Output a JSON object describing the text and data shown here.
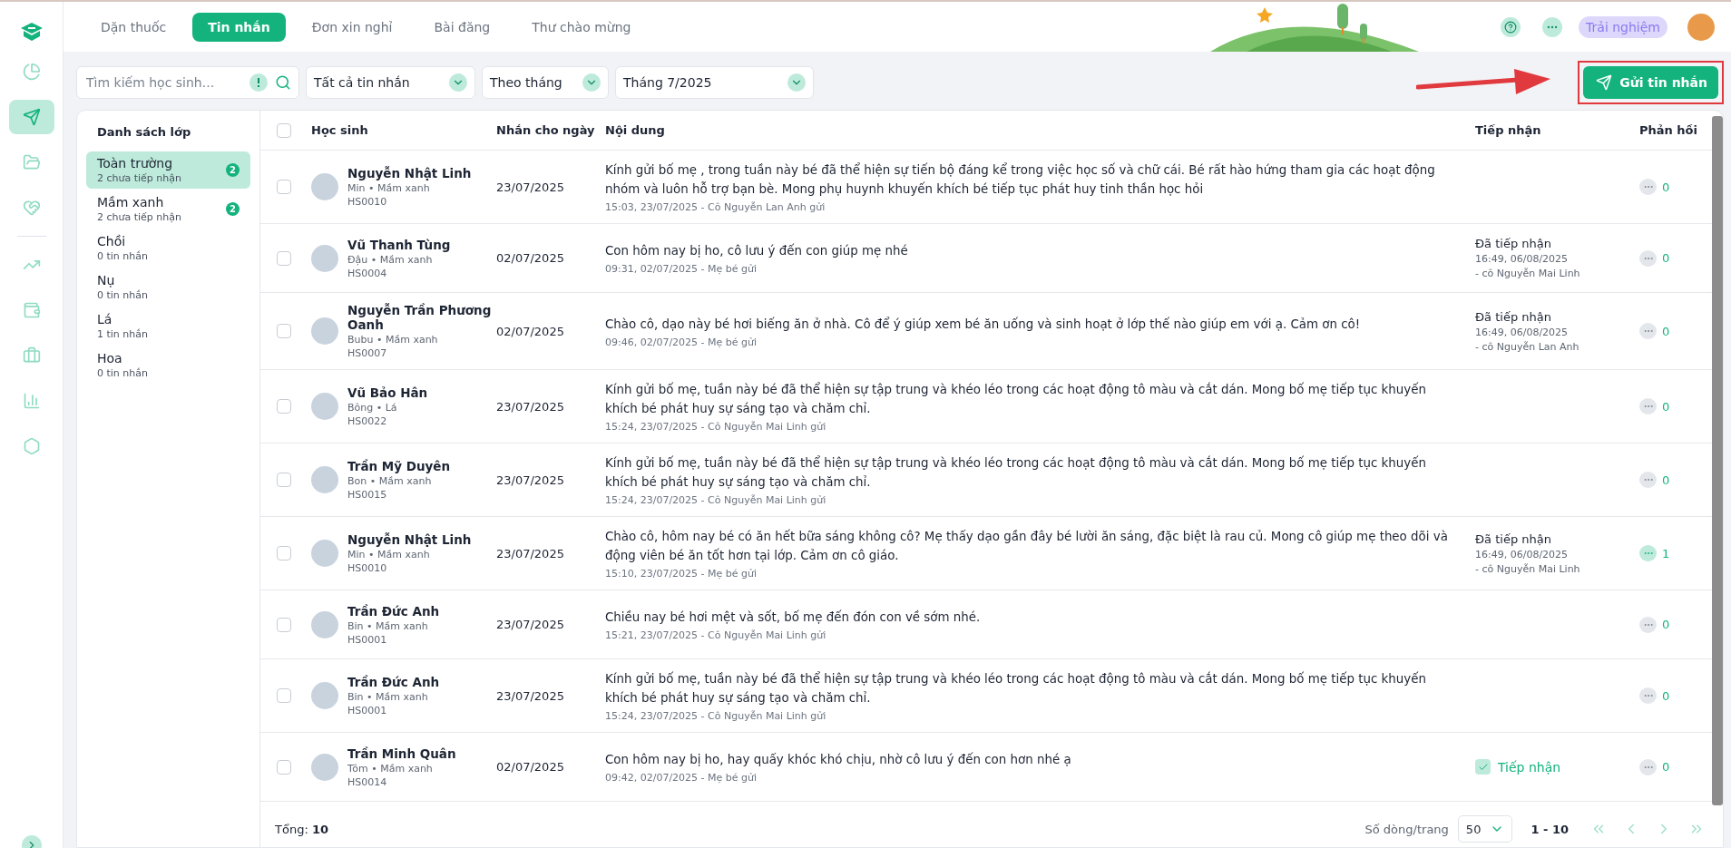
{
  "sidebar": {
    "items": [
      {
        "selected": false
      },
      {
        "selected": true
      },
      {
        "selected": false
      },
      {
        "selected": false
      },
      {
        "selected": false
      },
      {
        "selected": false
      },
      {
        "selected": false
      },
      {
        "selected": false
      },
      {
        "selected": false
      }
    ]
  },
  "tabs": [
    {
      "label": "Dặn thuốc",
      "selected": false
    },
    {
      "label": "Tin nhắn",
      "selected": true
    },
    {
      "label": "Đơn xin nghỉ",
      "selected": false
    },
    {
      "label": "Bài đăng",
      "selected": false
    },
    {
      "label": "Thư chào mừng",
      "selected": false
    }
  ],
  "header": {
    "trial_badge": "Trải nghiệm"
  },
  "filters": {
    "search": {
      "placeholder": "Tìm kiếm học sinh..."
    },
    "selects": [
      {
        "value": "Tất cả tin nhắn"
      },
      {
        "value": "Theo tháng"
      },
      {
        "value": "Tháng 7/2025"
      }
    ]
  },
  "send_button": {
    "label": "Gửi tin nhắn",
    "highlighted": true
  },
  "class_list": {
    "title": "Danh sách lớp",
    "items": [
      {
        "name": "Toàn trường",
        "subtitle": "2 chưa tiếp nhận",
        "badge": "2",
        "selected": true
      },
      {
        "name": "Mầm xanh",
        "subtitle": "2 chưa tiếp nhận",
        "badge": "2",
        "selected": false
      },
      {
        "name": "Chồi",
        "subtitle": "0 tin nhắn",
        "selected": false
      },
      {
        "name": "Nụ",
        "subtitle": "0 tin nhắn",
        "selected": false
      },
      {
        "name": "Lá",
        "subtitle": "1 tin nhắn",
        "selected": false
      },
      {
        "name": "Hoa",
        "subtitle": "0 tin nhắn",
        "selected": false
      }
    ]
  },
  "table": {
    "select_all_checked": false,
    "columns": [
      "Học sinh",
      "Nhắn cho ngày",
      "Nội dung",
      "Tiếp nhận",
      "Phản hồi"
    ],
    "rows": [
      {
        "checked": false,
        "name": "Nguyễn Nhật Linh",
        "info": "Min • Mầm xanh",
        "code": "HS0010",
        "date": "23/07/2025",
        "message": "Kính gửi bố mẹ , trong tuần này bé đã thể hiện sự tiến bộ đáng kể trong việc học số và chữ cái. Bé rất hào hứng tham gia các hoạt động nhóm và luôn hỗ trợ bạn bè. Mong phụ huynh khuyến khích bé tiếp tục phát huy tinh thần học hỏi",
        "meta": "15:03, 23/07/2025 - Cô Nguyễn Lan Anh gửi",
        "receipt": {
          "kind": "none"
        },
        "reply": {
          "count": "0",
          "active": false
        }
      },
      {
        "checked": false,
        "name": "Vũ Thanh Tùng",
        "info": "Đậu • Mầm xanh",
        "code": "HS0004",
        "date": "02/07/2025",
        "message": "Con hôm nay bị ho, cô lưu ý đến con giúp mẹ nhé",
        "meta": "09:31, 02/07/2025 - Mẹ bé gửi",
        "receipt": {
          "kind": "received",
          "status": "Đã tiếp nhận",
          "time": "16:49, 06/08/2025",
          "by": "- cô Nguyễn Mai Linh"
        },
        "reply": {
          "count": "0",
          "active": false
        }
      },
      {
        "checked": false,
        "name": "Nguyễn Trần Phương Oanh",
        "info": "Bubu • Mầm xanh",
        "code": "HS0007",
        "date": "02/07/2025",
        "message": "Chào cô, dạo này bé hơi biếng ăn ở nhà. Cô để ý giúp xem bé ăn uống và sinh hoạt ở lớp thế nào giúp em với ạ. Cảm ơn cô!",
        "meta": "09:46, 02/07/2025 - Mẹ bé gửi",
        "receipt": {
          "kind": "received",
          "status": "Đã tiếp nhận",
          "time": "16:49, 06/08/2025",
          "by": "- cô Nguyễn Lan Anh"
        },
        "reply": {
          "count": "0",
          "active": false
        }
      },
      {
        "checked": false,
        "name": "Vũ Bảo Hân",
        "info": "Bông • Lá",
        "code": "HS0022",
        "date": "23/07/2025",
        "message": "Kính gửi bố mẹ, tuần này bé đã thể hiện sự tập trung và khéo léo trong các hoạt động tô màu và cắt dán. Mong bố mẹ tiếp tục khuyến khích bé phát huy sự sáng tạo và chăm chỉ.",
        "meta": "15:24, 23/07/2025 - Cô Nguyễn Mai Linh gửi",
        "receipt": {
          "kind": "none"
        },
        "reply": {
          "count": "0",
          "active": false
        }
      },
      {
        "checked": false,
        "name": "Trần Mỹ Duyên",
        "info": "Bon • Mầm xanh",
        "code": "HS0015",
        "date": "23/07/2025",
        "message": "Kính gửi bố mẹ, tuần này bé đã thể hiện sự tập trung và khéo léo trong các hoạt động tô màu và cắt dán. Mong bố mẹ tiếp tục khuyến khích bé phát huy sự sáng tạo và chăm chỉ.",
        "meta": "15:24, 23/07/2025 - Cô Nguyễn Mai Linh gửi",
        "receipt": {
          "kind": "none"
        },
        "reply": {
          "count": "0",
          "active": false
        }
      },
      {
        "checked": false,
        "name": "Nguyễn Nhật Linh",
        "info": "Min • Mầm xanh",
        "code": "HS0010",
        "date": "23/07/2025",
        "message": "Chào cô, hôm nay bé có ăn hết bữa sáng không cô? Mẹ thấy dạo gần đây bé lười ăn sáng, đặc biệt là rau củ. Mong cô giúp mẹ theo dõi và động viên bé ăn tốt hơn tại lớp. Cảm ơn cô giáo.",
        "meta": "15:10, 23/07/2025 - Mẹ bé gửi",
        "receipt": {
          "kind": "received",
          "status": "Đã tiếp nhận",
          "time": "16:49, 06/08/2025",
          "by": "- cô Nguyễn Mai Linh"
        },
        "reply": {
          "count": "1",
          "active": true
        }
      },
      {
        "checked": false,
        "name": "Trần Đức Anh",
        "info": "Bin • Mầm xanh",
        "code": "HS0001",
        "date": "23/07/2025",
        "message": "Chiều nay bé hơi mệt và sốt, bố mẹ đến đón con về sớm nhé.",
        "meta": "15:21, 23/07/2025 - Cô Nguyễn Mai Linh gửi",
        "receipt": {
          "kind": "none"
        },
        "reply": {
          "count": "0",
          "active": false
        }
      },
      {
        "checked": false,
        "name": "Trần Đức Anh",
        "info": "Bin • Mầm xanh",
        "code": "HS0001",
        "date": "23/07/2025",
        "message": "Kính gửi bố mẹ, tuần này bé đã thể hiện sự tập trung và khéo léo trong các hoạt động tô màu và cắt dán. Mong bố mẹ tiếp tục khuyến khích bé phát huy sự sáng tạo và chăm chỉ.",
        "meta": "15:24, 23/07/2025 - Cô Nguyễn Mai Linh gửi",
        "receipt": {
          "kind": "none"
        },
        "reply": {
          "count": "0",
          "active": false
        }
      },
      {
        "checked": false,
        "name": "Trần Minh Quân",
        "info": "Tôm • Mầm xanh",
        "code": "HS0014",
        "date": "02/07/2025",
        "message": "Con hôm nay bị ho, hay quấy khóc khó chịu, nhờ cô lưu ý đến con hơn nhé ạ",
        "meta": "09:42, 02/07/2025 - Mẹ bé gửi",
        "receipt": {
          "kind": "action",
          "label": "Tiếp nhận"
        },
        "reply": {
          "count": "0",
          "active": false
        }
      }
    ]
  },
  "footer": {
    "total": "Tổng: **10**",
    "rows_per_page_label": "Số dòng/trang",
    "rows_per_page": "50",
    "range": "1 - 10"
  }
}
